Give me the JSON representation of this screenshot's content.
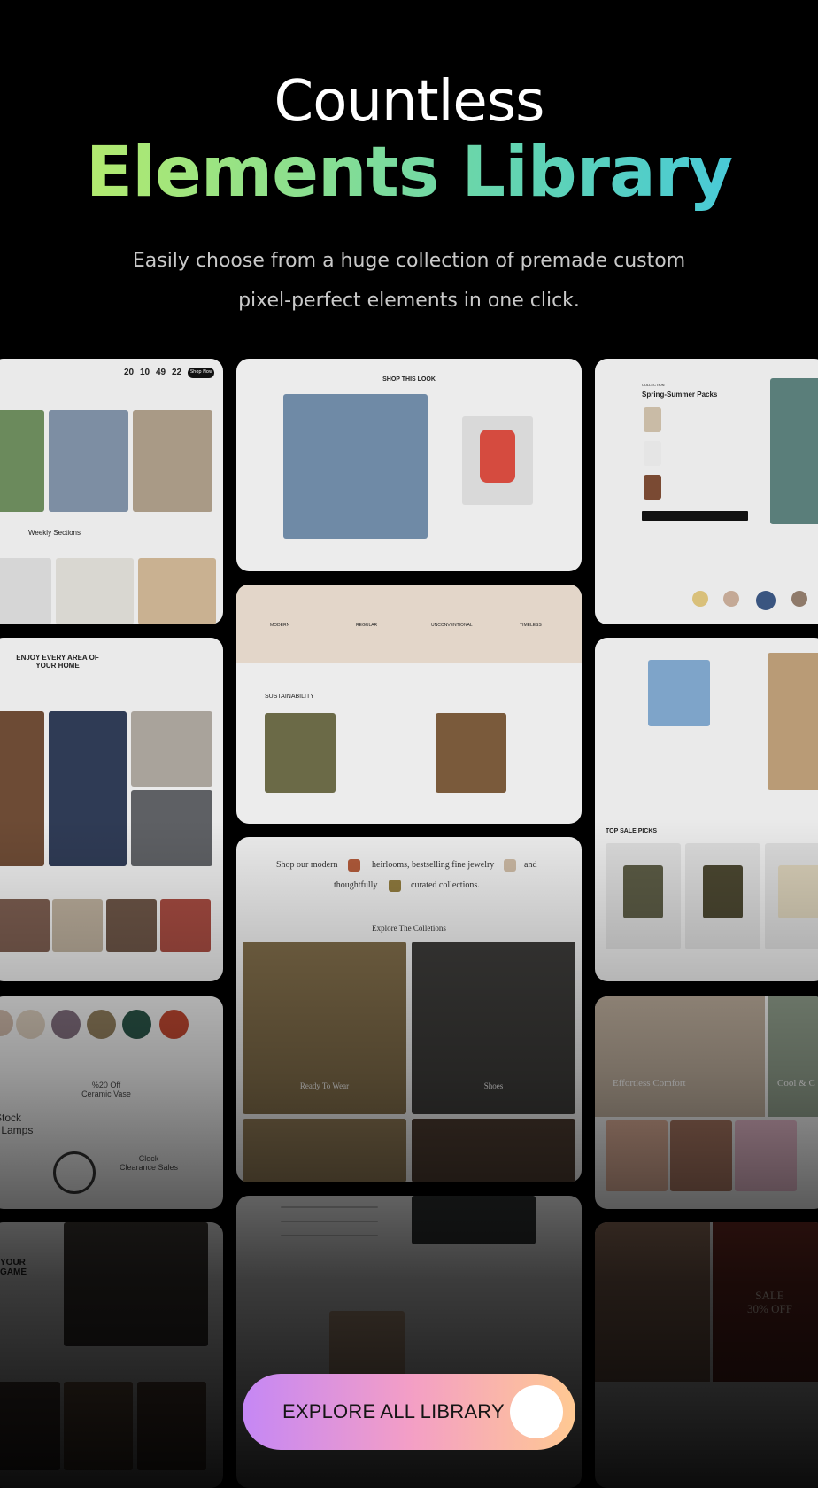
{
  "hero": {
    "title_line1": "Countless",
    "title_line2": "Elements Library",
    "subtitle_line1": "Easily choose from a huge collection of premade custom",
    "subtitle_line2": "pixel-perfect elements in one click."
  },
  "cards": {
    "countdown": {
      "days": "20",
      "hours": "10",
      "minutes": "49",
      "seconds": "22",
      "button": "Shop Now",
      "section": "Weekly Sections"
    },
    "shop_look": {
      "title": "SHOP THIS LOOK"
    },
    "spring": {
      "kicker": "COLLECTION",
      "title": "Spring-Summer Packs"
    },
    "features": {
      "items": [
        "MODERN",
        "REGULAR",
        "UNCONVENTIONAL",
        "TIMELESS"
      ],
      "section": "SUSTAINABILITY"
    },
    "enjoy": {
      "title_line1": "ENJOY EVERY AREA OF",
      "title_line2": "YOUR HOME"
    },
    "sale_picks": {
      "title": "TOP SALE PICKS"
    },
    "shop_modern": {
      "line1a": "Shop our modern",
      "line1b": "heirlooms, bestselling fine jewelry",
      "line1c": "and",
      "line2a": "thoughtfully",
      "line2b": "curated collections.",
      "explore": "Explore The Colletions",
      "tile1": "Ready To Wear",
      "tile2": "Shoes"
    },
    "vase": {
      "line1": "%20 Off",
      "line2": "Ceramic Vase",
      "stock1": "Stock",
      "stock2": "r Lamps",
      "clock1": "Clock",
      "clock2": "Clearance Sales"
    },
    "comfort": {
      "tile1": "Effortless Comfort",
      "tile2": "Cool & C"
    },
    "your_game": {
      "line1": "YOUR",
      "line2": "GAME"
    },
    "sale30": {
      "line1": "SALE",
      "line2": "30% OFF"
    }
  },
  "cta": {
    "label": "EXPLORE ALL LIBRARY"
  }
}
